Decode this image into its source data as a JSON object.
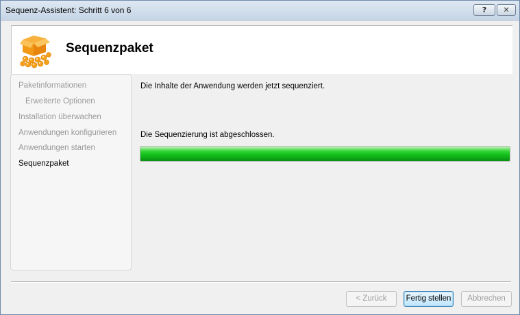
{
  "window": {
    "title": "Sequenz-Assistent: Schritt 6 von 6",
    "help_glyph": "?",
    "close_glyph": "✕"
  },
  "header": {
    "title": "Sequenzpaket",
    "icon": "package-icon"
  },
  "nav": {
    "items": [
      {
        "label": "Paketinformationen",
        "state": "done"
      },
      {
        "label": "Erweiterte Optionen",
        "state": "done"
      },
      {
        "label": "Installation überwachen",
        "state": "done"
      },
      {
        "label": "Anwendungen konfigurieren",
        "state": "done"
      },
      {
        "label": "Anwendungen starten",
        "state": "done"
      },
      {
        "label": "Sequenzpaket",
        "state": "active"
      }
    ]
  },
  "main": {
    "intro_text": "Die Inhalte der Anwendung werden jetzt sequenziert.",
    "status_text": "Die Sequenzierung ist abgeschlossen.",
    "progress": 1.0,
    "progress_color": "#14c21c"
  },
  "buttons": {
    "back_label": "< Zurück",
    "finish_label": "Fertig stellen",
    "cancel_label": "Abbrechen"
  },
  "colors": {
    "accent_orange": "#f5a01a",
    "primary_button_border": "#3c7fb1"
  }
}
